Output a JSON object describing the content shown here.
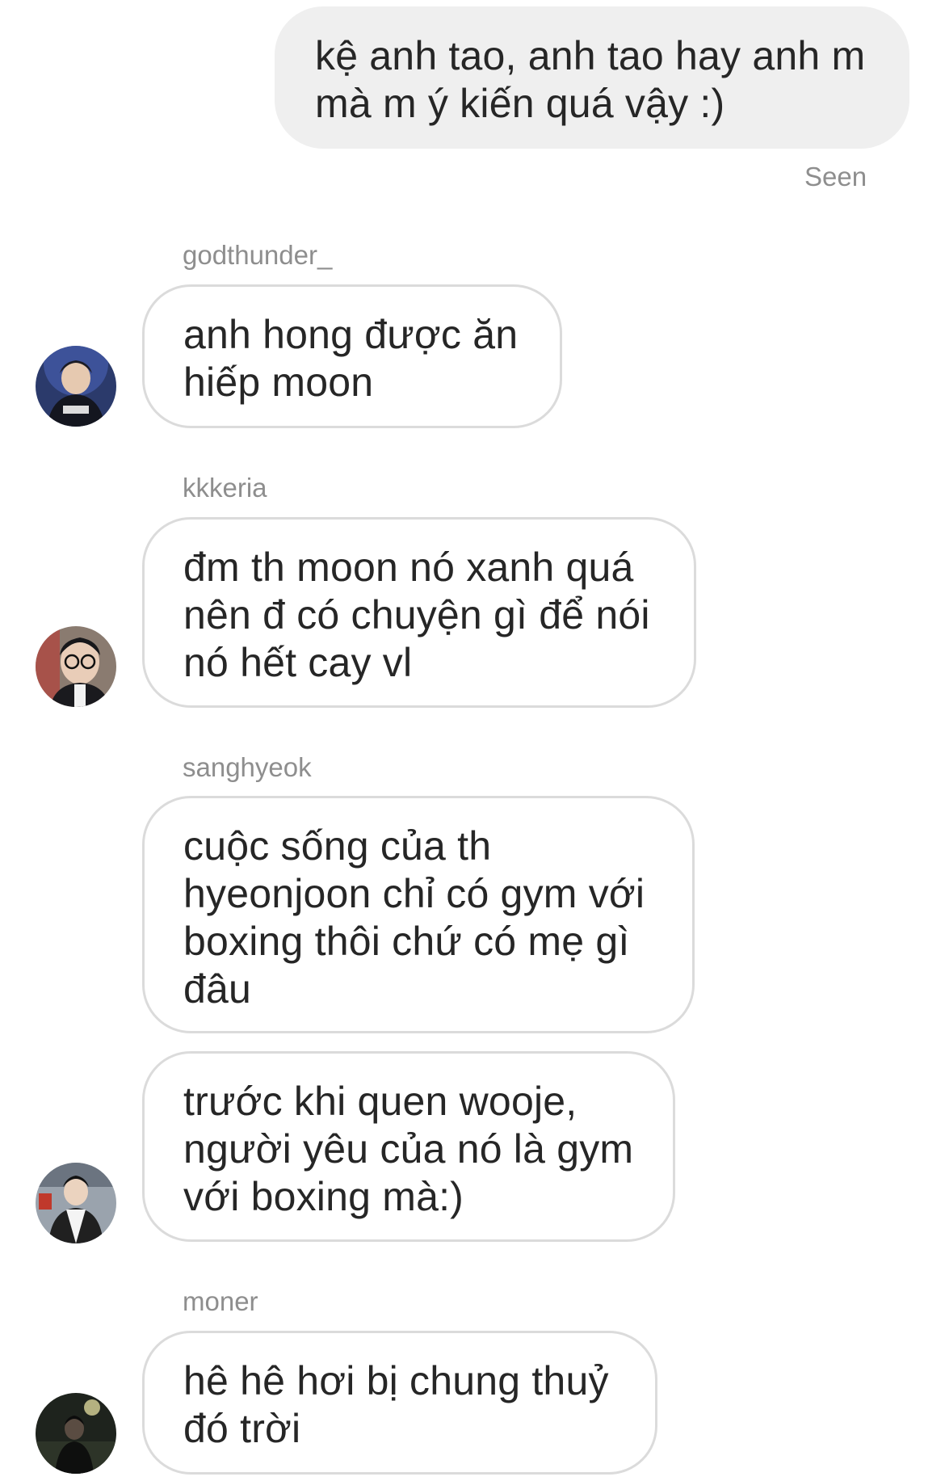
{
  "thread": {
    "sent": {
      "text": "kệ anh tao, anh tao hay anh m\nmà m ý kiến quá vậy :)",
      "status": "Seen"
    },
    "groups": [
      {
        "sender": "godthunder_",
        "avatar_icon": "user-avatar-photo",
        "messages": [
          "anh hong được ăn\nhiếp moon"
        ]
      },
      {
        "sender": "kkkeria",
        "avatar_icon": "user-avatar-photo",
        "messages": [
          "đm th moon nó xanh quá\nnên đ có chuyện gì để nói\nnó hết cay vl"
        ]
      },
      {
        "sender": "sanghyeok",
        "avatar_icon": "user-avatar-photo",
        "messages": [
          "cuộc sống của th\nhyeonjoon chỉ có gym với\nboxing thôi chứ có mẹ gì\nđâu",
          "trước khi quen wooje,\nngười yêu của nó là gym\nvới boxing mà:)"
        ]
      },
      {
        "sender": "moner",
        "avatar_icon": "user-avatar-photo",
        "messages": [
          "hê hê hơi bị chung thuỷ\nđó trời"
        ]
      }
    ]
  },
  "colors": {
    "sent_bubble_bg": "#efefef",
    "received_bubble_border": "#dbdbdb",
    "meta_text": "#8e8e8e",
    "message_text": "#262626"
  }
}
